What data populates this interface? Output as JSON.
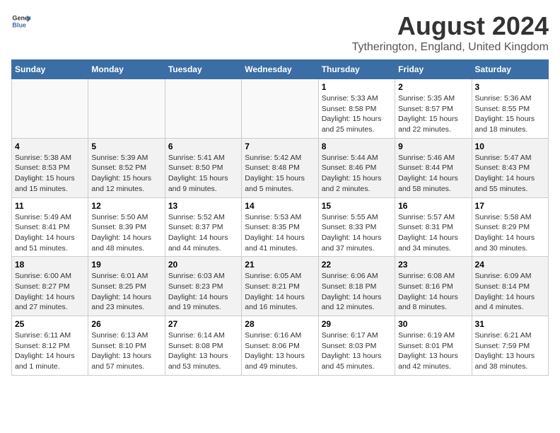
{
  "header": {
    "logo_general": "General",
    "logo_blue": "Blue",
    "main_title": "August 2024",
    "subtitle": "Tytherington, England, United Kingdom"
  },
  "weekdays": [
    "Sunday",
    "Monday",
    "Tuesday",
    "Wednesday",
    "Thursday",
    "Friday",
    "Saturday"
  ],
  "weeks": [
    [
      {
        "day": "",
        "info": ""
      },
      {
        "day": "",
        "info": ""
      },
      {
        "day": "",
        "info": ""
      },
      {
        "day": "",
        "info": ""
      },
      {
        "day": "1",
        "info": "Sunrise: 5:33 AM\nSunset: 8:58 PM\nDaylight: 15 hours\nand 25 minutes."
      },
      {
        "day": "2",
        "info": "Sunrise: 5:35 AM\nSunset: 8:57 PM\nDaylight: 15 hours\nand 22 minutes."
      },
      {
        "day": "3",
        "info": "Sunrise: 5:36 AM\nSunset: 8:55 PM\nDaylight: 15 hours\nand 18 minutes."
      }
    ],
    [
      {
        "day": "4",
        "info": "Sunrise: 5:38 AM\nSunset: 8:53 PM\nDaylight: 15 hours\nand 15 minutes."
      },
      {
        "day": "5",
        "info": "Sunrise: 5:39 AM\nSunset: 8:52 PM\nDaylight: 15 hours\nand 12 minutes."
      },
      {
        "day": "6",
        "info": "Sunrise: 5:41 AM\nSunset: 8:50 PM\nDaylight: 15 hours\nand 9 minutes."
      },
      {
        "day": "7",
        "info": "Sunrise: 5:42 AM\nSunset: 8:48 PM\nDaylight: 15 hours\nand 5 minutes."
      },
      {
        "day": "8",
        "info": "Sunrise: 5:44 AM\nSunset: 8:46 PM\nDaylight: 15 hours\nand 2 minutes."
      },
      {
        "day": "9",
        "info": "Sunrise: 5:46 AM\nSunset: 8:44 PM\nDaylight: 14 hours\nand 58 minutes."
      },
      {
        "day": "10",
        "info": "Sunrise: 5:47 AM\nSunset: 8:43 PM\nDaylight: 14 hours\nand 55 minutes."
      }
    ],
    [
      {
        "day": "11",
        "info": "Sunrise: 5:49 AM\nSunset: 8:41 PM\nDaylight: 14 hours\nand 51 minutes."
      },
      {
        "day": "12",
        "info": "Sunrise: 5:50 AM\nSunset: 8:39 PM\nDaylight: 14 hours\nand 48 minutes."
      },
      {
        "day": "13",
        "info": "Sunrise: 5:52 AM\nSunset: 8:37 PM\nDaylight: 14 hours\nand 44 minutes."
      },
      {
        "day": "14",
        "info": "Sunrise: 5:53 AM\nSunset: 8:35 PM\nDaylight: 14 hours\nand 41 minutes."
      },
      {
        "day": "15",
        "info": "Sunrise: 5:55 AM\nSunset: 8:33 PM\nDaylight: 14 hours\nand 37 minutes."
      },
      {
        "day": "16",
        "info": "Sunrise: 5:57 AM\nSunset: 8:31 PM\nDaylight: 14 hours\nand 34 minutes."
      },
      {
        "day": "17",
        "info": "Sunrise: 5:58 AM\nSunset: 8:29 PM\nDaylight: 14 hours\nand 30 minutes."
      }
    ],
    [
      {
        "day": "18",
        "info": "Sunrise: 6:00 AM\nSunset: 8:27 PM\nDaylight: 14 hours\nand 27 minutes."
      },
      {
        "day": "19",
        "info": "Sunrise: 6:01 AM\nSunset: 8:25 PM\nDaylight: 14 hours\nand 23 minutes."
      },
      {
        "day": "20",
        "info": "Sunrise: 6:03 AM\nSunset: 8:23 PM\nDaylight: 14 hours\nand 19 minutes."
      },
      {
        "day": "21",
        "info": "Sunrise: 6:05 AM\nSunset: 8:21 PM\nDaylight: 14 hours\nand 16 minutes."
      },
      {
        "day": "22",
        "info": "Sunrise: 6:06 AM\nSunset: 8:18 PM\nDaylight: 14 hours\nand 12 minutes."
      },
      {
        "day": "23",
        "info": "Sunrise: 6:08 AM\nSunset: 8:16 PM\nDaylight: 14 hours\nand 8 minutes."
      },
      {
        "day": "24",
        "info": "Sunrise: 6:09 AM\nSunset: 8:14 PM\nDaylight: 14 hours\nand 4 minutes."
      }
    ],
    [
      {
        "day": "25",
        "info": "Sunrise: 6:11 AM\nSunset: 8:12 PM\nDaylight: 14 hours\nand 1 minute."
      },
      {
        "day": "26",
        "info": "Sunrise: 6:13 AM\nSunset: 8:10 PM\nDaylight: 13 hours\nand 57 minutes."
      },
      {
        "day": "27",
        "info": "Sunrise: 6:14 AM\nSunset: 8:08 PM\nDaylight: 13 hours\nand 53 minutes."
      },
      {
        "day": "28",
        "info": "Sunrise: 6:16 AM\nSunset: 8:06 PM\nDaylight: 13 hours\nand 49 minutes."
      },
      {
        "day": "29",
        "info": "Sunrise: 6:17 AM\nSunset: 8:03 PM\nDaylight: 13 hours\nand 45 minutes."
      },
      {
        "day": "30",
        "info": "Sunrise: 6:19 AM\nSunset: 8:01 PM\nDaylight: 13 hours\nand 42 minutes."
      },
      {
        "day": "31",
        "info": "Sunrise: 6:21 AM\nSunset: 7:59 PM\nDaylight: 13 hours\nand 38 minutes."
      }
    ]
  ]
}
